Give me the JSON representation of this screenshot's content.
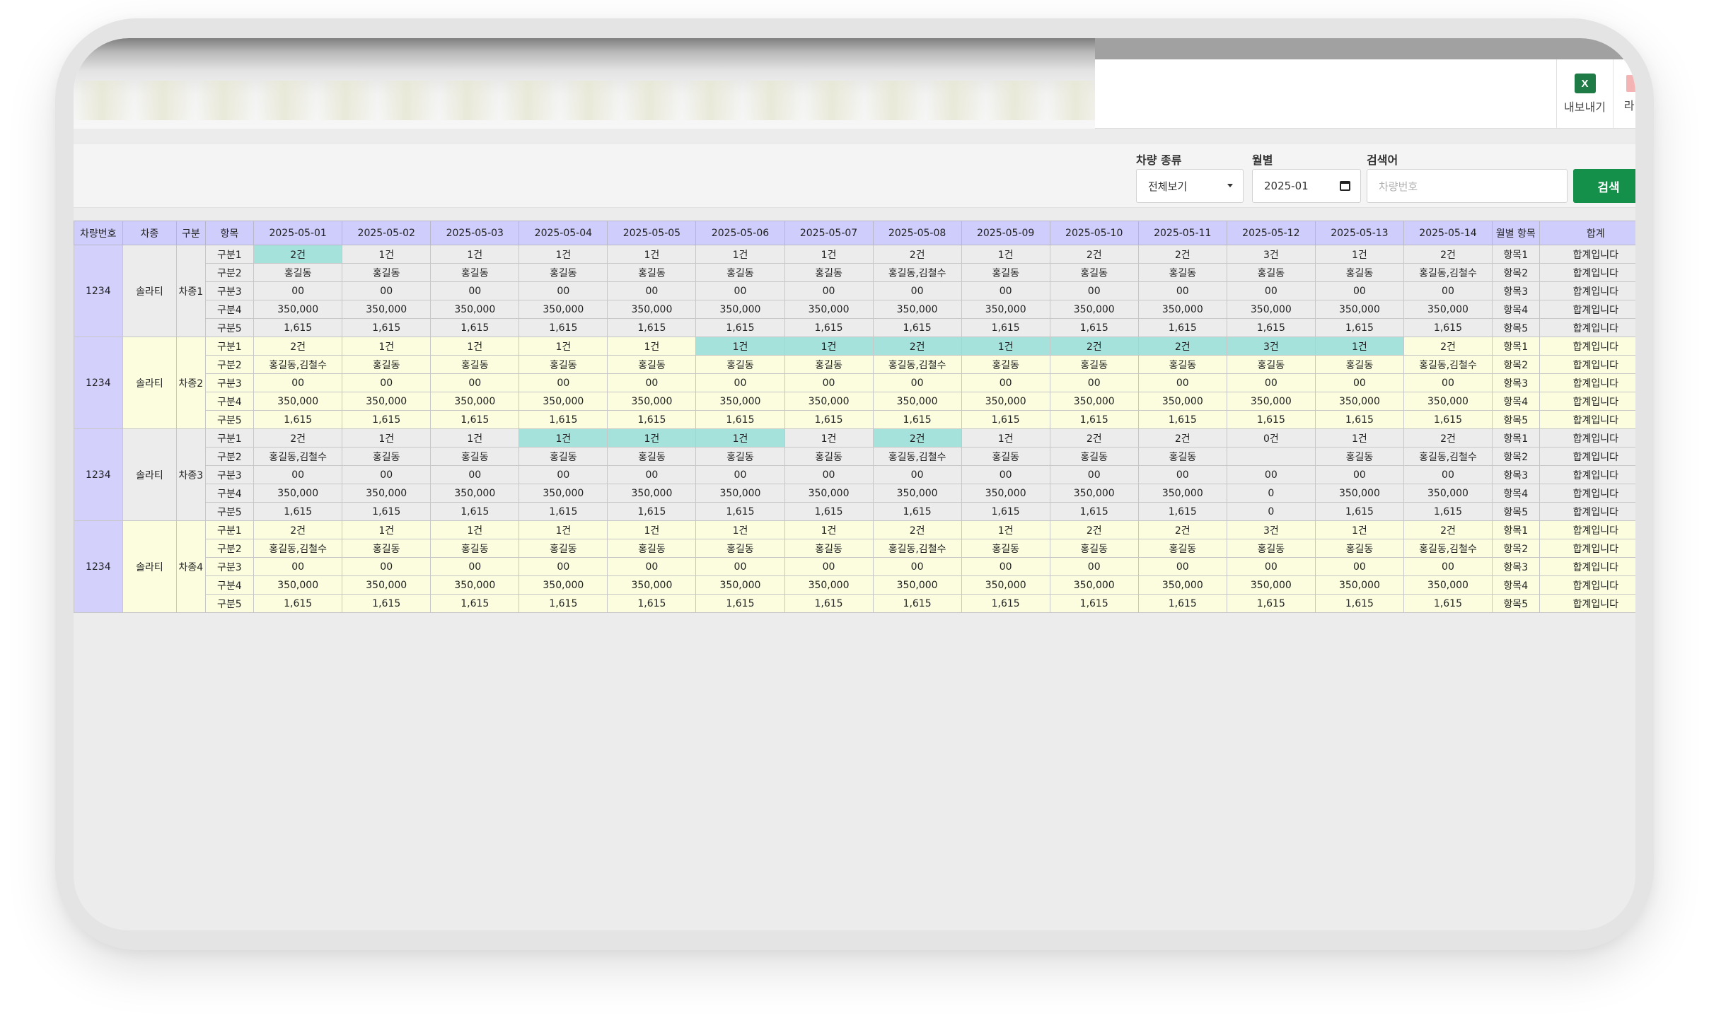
{
  "toolbar": {
    "export_label": "내보내기",
    "excel_icon_text": "X",
    "label_label": "라벨"
  },
  "filters": {
    "vehicle_type_label": "차량 종류",
    "vehicle_type_value": "전체보기",
    "month_label": "월별",
    "month_value": "2025-01",
    "search_label": "검색어",
    "search_placeholder": "차량번호",
    "search_button": "검색"
  },
  "colors": {
    "header": "#cfcdfc",
    "alt_row": "#fbfdde",
    "highlight": "#a6e2dc",
    "search_button": "#14904b"
  },
  "table": {
    "headers": [
      "차량번호",
      "차종",
      "구분",
      "항목",
      "2025-05-01",
      "2025-05-02",
      "2025-05-03",
      "2025-05-04",
      "2025-05-05",
      "2025-05-06",
      "2025-05-07",
      "2025-05-08",
      "2025-05-09",
      "2025-05-10",
      "2025-05-11",
      "2025-05-12",
      "2025-05-13",
      "2025-05-14",
      "월별 항목",
      "합계"
    ],
    "groups": [
      {
        "vehicle_no": "1234",
        "car_type": "솔라티",
        "division": "차종1",
        "alt": false,
        "rows": [
          {
            "item": "구분1",
            "cells": [
              "2건",
              "1건",
              "1건",
              "1건",
              "1건",
              "1건",
              "1건",
              "2건",
              "1건",
              "2건",
              "2건",
              "3건",
              "1건",
              "2건"
            ],
            "hl": [
              0
            ],
            "monthly": "항목1",
            "total": "합계입니다"
          },
          {
            "item": "구분2",
            "cells": [
              "홍길동",
              "홍길동",
              "홍길동",
              "홍길동",
              "홍길동",
              "홍길동",
              "홍길동",
              "홍길동,김철수",
              "홍길동",
              "홍길동",
              "홍길동",
              "홍길동",
              "홍길동",
              "홍길동,김철수"
            ],
            "hl": [],
            "monthly": "항목2",
            "total": "합계입니다"
          },
          {
            "item": "구분3",
            "cells": [
              "00",
              "00",
              "00",
              "00",
              "00",
              "00",
              "00",
              "00",
              "00",
              "00",
              "00",
              "00",
              "00",
              "00"
            ],
            "hl": [],
            "monthly": "항목3",
            "total": "합계입니다"
          },
          {
            "item": "구분4",
            "cells": [
              "350,000",
              "350,000",
              "350,000",
              "350,000",
              "350,000",
              "350,000",
              "350,000",
              "350,000",
              "350,000",
              "350,000",
              "350,000",
              "350,000",
              "350,000",
              "350,000"
            ],
            "hl": [],
            "monthly": "항목4",
            "total": "합계입니다"
          },
          {
            "item": "구분5",
            "cells": [
              "1,615",
              "1,615",
              "1,615",
              "1,615",
              "1,615",
              "1,615",
              "1,615",
              "1,615",
              "1,615",
              "1,615",
              "1,615",
              "1,615",
              "1,615",
              "1,615"
            ],
            "hl": [],
            "monthly": "항목5",
            "total": "합계입니다"
          }
        ]
      },
      {
        "vehicle_no": "1234",
        "car_type": "솔라티",
        "division": "차종2",
        "alt": true,
        "rows": [
          {
            "item": "구분1",
            "cells": [
              "2건",
              "1건",
              "1건",
              "1건",
              "1건",
              "1건",
              "1건",
              "2건",
              "1건",
              "2건",
              "2건",
              "3건",
              "1건",
              "2건"
            ],
            "hl": [
              5,
              6,
              7,
              8,
              9,
              10,
              11,
              12
            ],
            "monthly": "항목1",
            "total": "합계입니다"
          },
          {
            "item": "구분2",
            "cells": [
              "홍길동,김철수",
              "홍길동",
              "홍길동",
              "홍길동",
              "홍길동",
              "홍길동",
              "홍길동",
              "홍길동,김철수",
              "홍길동",
              "홍길동",
              "홍길동",
              "홍길동",
              "홍길동",
              "홍길동,김철수"
            ],
            "hl": [],
            "monthly": "항목2",
            "total": "합계입니다"
          },
          {
            "item": "구분3",
            "cells": [
              "00",
              "00",
              "00",
              "00",
              "00",
              "00",
              "00",
              "00",
              "00",
              "00",
              "00",
              "00",
              "00",
              "00"
            ],
            "hl": [],
            "monthly": "항목3",
            "total": "합계입니다"
          },
          {
            "item": "구분4",
            "cells": [
              "350,000",
              "350,000",
              "350,000",
              "350,000",
              "350,000",
              "350,000",
              "350,000",
              "350,000",
              "350,000",
              "350,000",
              "350,000",
              "350,000",
              "350,000",
              "350,000"
            ],
            "hl": [],
            "monthly": "항목4",
            "total": "합계입니다"
          },
          {
            "item": "구분5",
            "cells": [
              "1,615",
              "1,615",
              "1,615",
              "1,615",
              "1,615",
              "1,615",
              "1,615",
              "1,615",
              "1,615",
              "1,615",
              "1,615",
              "1,615",
              "1,615",
              "1,615"
            ],
            "hl": [],
            "monthly": "항목5",
            "total": "합계입니다"
          }
        ]
      },
      {
        "vehicle_no": "1234",
        "car_type": "솔라티",
        "division": "차종3",
        "alt": false,
        "rows": [
          {
            "item": "구분1",
            "cells": [
              "2건",
              "1건",
              "1건",
              "1건",
              "1건",
              "1건",
              "1건",
              "2건",
              "1건",
              "2건",
              "2건",
              "0건",
              "1건",
              "2건"
            ],
            "hl": [
              3,
              4,
              5,
              7
            ],
            "monthly": "항목1",
            "total": "합계입니다"
          },
          {
            "item": "구분2",
            "cells": [
              "홍길동,김철수",
              "홍길동",
              "홍길동",
              "홍길동",
              "홍길동",
              "홍길동",
              "홍길동",
              "홍길동,김철수",
              "홍길동",
              "홍길동",
              "홍길동",
              "",
              "홍길동",
              "홍길동,김철수"
            ],
            "hl": [],
            "monthly": "항목2",
            "total": "합계입니다"
          },
          {
            "item": "구분3",
            "cells": [
              "00",
              "00",
              "00",
              "00",
              "00",
              "00",
              "00",
              "00",
              "00",
              "00",
              "00",
              "00",
              "00",
              "00"
            ],
            "hl": [],
            "monthly": "항목3",
            "total": "합계입니다"
          },
          {
            "item": "구분4",
            "cells": [
              "350,000",
              "350,000",
              "350,000",
              "350,000",
              "350,000",
              "350,000",
              "350,000",
              "350,000",
              "350,000",
              "350,000",
              "350,000",
              "0",
              "350,000",
              "350,000"
            ],
            "hl": [],
            "monthly": "항목4",
            "total": "합계입니다"
          },
          {
            "item": "구분5",
            "cells": [
              "1,615",
              "1,615",
              "1,615",
              "1,615",
              "1,615",
              "1,615",
              "1,615",
              "1,615",
              "1,615",
              "1,615",
              "1,615",
              "0",
              "1,615",
              "1,615"
            ],
            "hl": [],
            "monthly": "항목5",
            "total": "합계입니다"
          }
        ]
      },
      {
        "vehicle_no": "1234",
        "car_type": "솔라티",
        "division": "차종4",
        "alt": true,
        "rows": [
          {
            "item": "구분1",
            "cells": [
              "2건",
              "1건",
              "1건",
              "1건",
              "1건",
              "1건",
              "1건",
              "2건",
              "1건",
              "2건",
              "2건",
              "3건",
              "1건",
              "2건"
            ],
            "hl": [],
            "monthly": "항목1",
            "total": "합계입니다"
          },
          {
            "item": "구분2",
            "cells": [
              "홍길동,김철수",
              "홍길동",
              "홍길동",
              "홍길동",
              "홍길동",
              "홍길동",
              "홍길동",
              "홍길동,김철수",
              "홍길동",
              "홍길동",
              "홍길동",
              "홍길동",
              "홍길동",
              "홍길동,김철수"
            ],
            "hl": [],
            "monthly": "항목2",
            "total": "합계입니다"
          },
          {
            "item": "구분3",
            "cells": [
              "00",
              "00",
              "00",
              "00",
              "00",
              "00",
              "00",
              "00",
              "00",
              "00",
              "00",
              "00",
              "00",
              "00"
            ],
            "hl": [],
            "monthly": "항목3",
            "total": "합계입니다"
          },
          {
            "item": "구분4",
            "cells": [
              "350,000",
              "350,000",
              "350,000",
              "350,000",
              "350,000",
              "350,000",
              "350,000",
              "350,000",
              "350,000",
              "350,000",
              "350,000",
              "350,000",
              "350,000",
              "350,000"
            ],
            "hl": [],
            "monthly": "항목4",
            "total": "합계입니다"
          },
          {
            "item": "구분5",
            "cells": [
              "1,615",
              "1,615",
              "1,615",
              "1,615",
              "1,615",
              "1,615",
              "1,615",
              "1,615",
              "1,615",
              "1,615",
              "1,615",
              "1,615",
              "1,615",
              "1,615"
            ],
            "hl": [],
            "monthly": "항목5",
            "total": "합계입니다"
          }
        ]
      }
    ]
  }
}
